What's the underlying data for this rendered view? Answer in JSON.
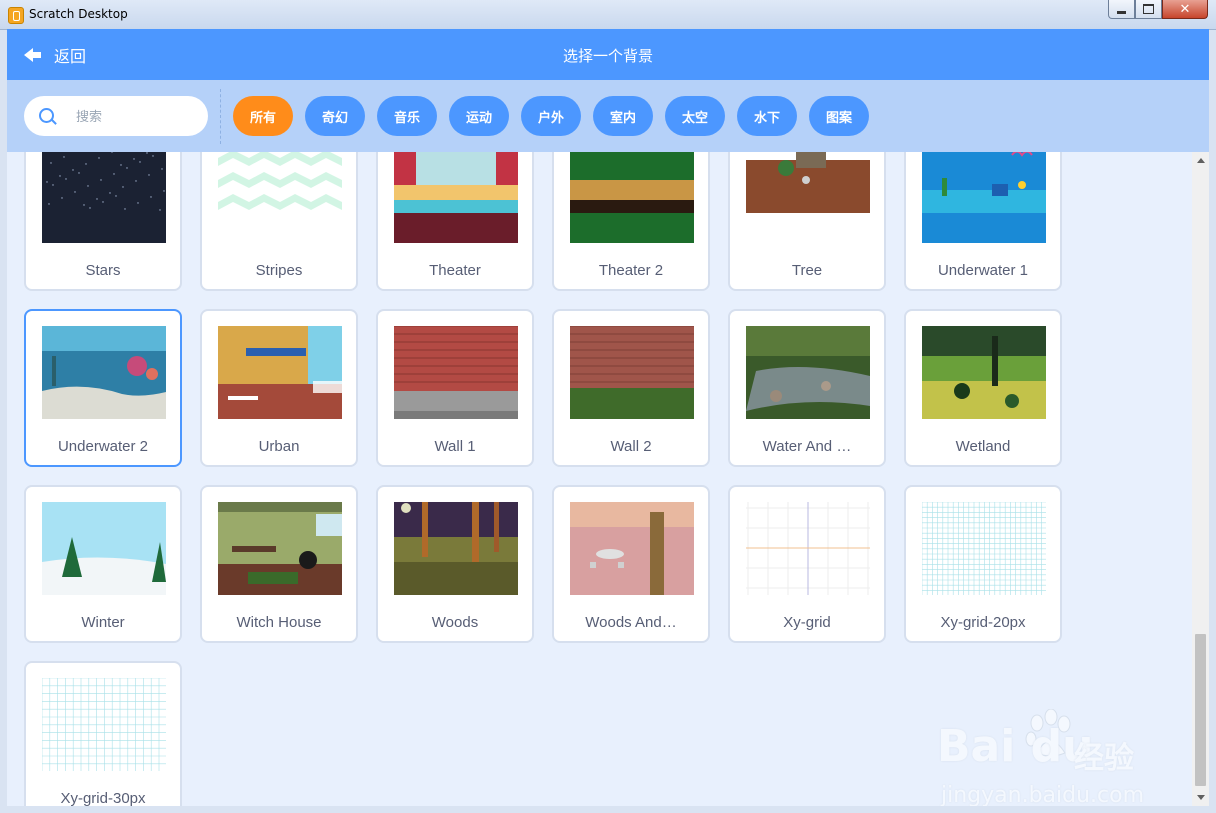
{
  "window": {
    "title": "Scratch Desktop",
    "minimize": "minimize",
    "maximize": "maximize",
    "close": "✕"
  },
  "header": {
    "back_label": "返回",
    "title": "选择一个背景"
  },
  "search": {
    "placeholder": "搜索"
  },
  "tags": [
    {
      "label": "所有",
      "active": true
    },
    {
      "label": "奇幻"
    },
    {
      "label": "音乐"
    },
    {
      "label": "运动"
    },
    {
      "label": "户外"
    },
    {
      "label": "室内"
    },
    {
      "label": "太空"
    },
    {
      "label": "水下"
    },
    {
      "label": "图案"
    }
  ],
  "backdrops": [
    {
      "name": "Stars",
      "icon": "stars-backdrop-thumbnail"
    },
    {
      "name": "Stripes",
      "icon": "stripes-backdrop-thumbnail"
    },
    {
      "name": "Theater",
      "icon": "theater-backdrop-thumbnail"
    },
    {
      "name": "Theater 2",
      "icon": "theater-2-backdrop-thumbnail"
    },
    {
      "name": "Tree",
      "icon": "tree-backdrop-thumbnail"
    },
    {
      "name": "Underwater 1",
      "icon": "underwater-1-backdrop-thumbnail"
    },
    {
      "name": "Underwater 2",
      "icon": "underwater-2-backdrop-thumbnail",
      "selected": true
    },
    {
      "name": "Urban",
      "icon": "urban-backdrop-thumbnail"
    },
    {
      "name": "Wall 1",
      "icon": "wall-1-backdrop-thumbnail"
    },
    {
      "name": "Wall 2",
      "icon": "wall-2-backdrop-thumbnail"
    },
    {
      "name": "Water And …",
      "icon": "water-and-rocks-backdrop-thumbnail"
    },
    {
      "name": "Wetland",
      "icon": "wetland-backdrop-thumbnail"
    },
    {
      "name": "Winter",
      "icon": "winter-backdrop-thumbnail"
    },
    {
      "name": "Witch House",
      "icon": "witch-house-backdrop-thumbnail"
    },
    {
      "name": "Woods",
      "icon": "woods-backdrop-thumbnail"
    },
    {
      "name": "Woods And…",
      "icon": "woods-and-bench-backdrop-thumbnail"
    },
    {
      "name": "Xy-grid",
      "icon": "xy-grid-backdrop-thumbnail"
    },
    {
      "name": "Xy-grid-20px",
      "icon": "xy-grid-20px-backdrop-thumbnail"
    },
    {
      "name": "Xy-grid-30px",
      "icon": "xy-grid-30px-backdrop-thumbnail"
    }
  ],
  "watermark": {
    "logo": "Bai du",
    "brand": "经验",
    "url": "jingyan.baidu.com"
  },
  "colors": {
    "header": "#4c97ff",
    "filterbar": "#b5d1f9",
    "active_tag": "#ff8c1a",
    "tag": "#4c97ff",
    "selected_border": "#4c97ff",
    "label": "#575e75"
  }
}
